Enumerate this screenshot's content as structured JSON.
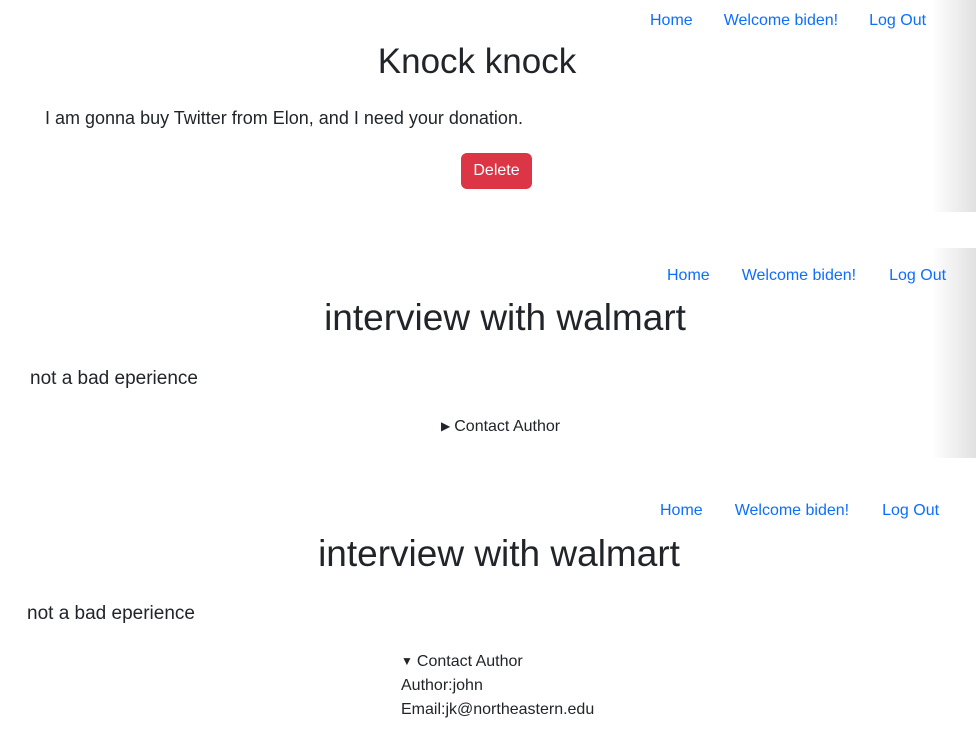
{
  "panels": [
    {
      "nav": {
        "home": "Home",
        "welcome": "Welcome biden!",
        "logout": "Log Out"
      },
      "title": "Knock knock",
      "content": "I am gonna buy Twitter from Elon, and I need your donation.",
      "delete_label": "Delete"
    },
    {
      "nav": {
        "home": "Home",
        "welcome": "Welcome biden!",
        "logout": "Log Out"
      },
      "title": "interview with walmart",
      "content": "not a bad eperience",
      "details": {
        "summary_icon": "▶",
        "summary": "Contact Author",
        "expanded": false
      }
    },
    {
      "nav": {
        "home": "Home",
        "welcome": "Welcome biden!",
        "logout": "Log Out"
      },
      "title": "interview with walmart",
      "content": "not a bad eperience",
      "details": {
        "summary_icon": "▼",
        "summary": "Contact Author",
        "expanded": true,
        "author_line": "Author:john",
        "email_line": "Email:jk@northeastern.edu"
      }
    }
  ],
  "colors": {
    "link": "#0d6efd",
    "danger": "#dc3545",
    "text": "#212529"
  }
}
